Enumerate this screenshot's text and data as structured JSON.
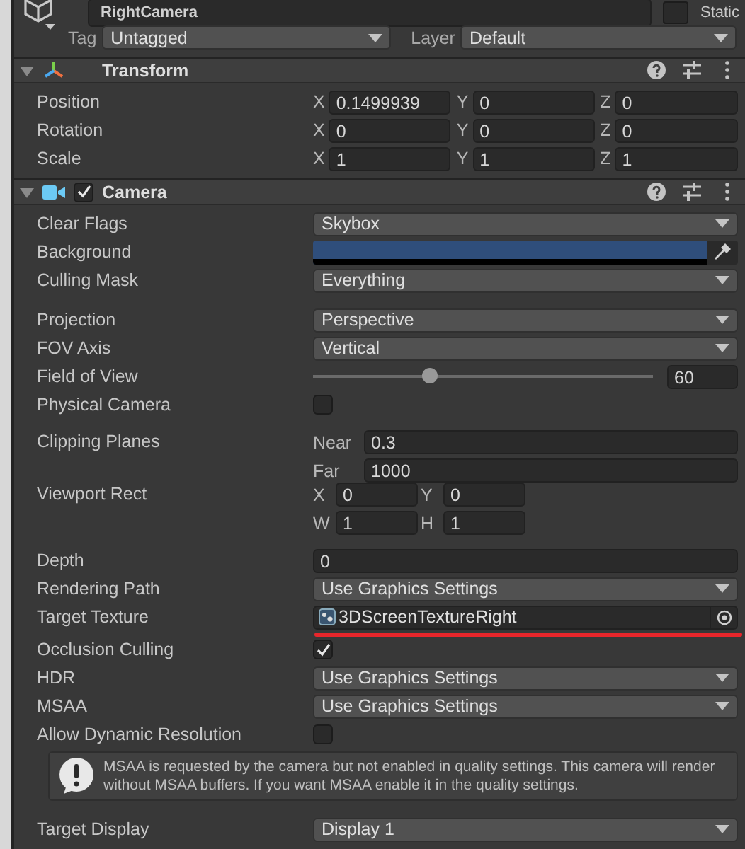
{
  "object_header": {
    "name": "RightCamera",
    "static_label": "Static",
    "static": false,
    "tag_label": "Tag",
    "tag": "Untagged",
    "layer_label": "Layer",
    "layer": "Default"
  },
  "components": [
    {
      "kind": "transform",
      "title": "Transform",
      "expanded": true,
      "rows": [
        {
          "label": "Position",
          "fields": [
            {
              "axis": "X",
              "value": "0.1499939"
            },
            {
              "axis": "Y",
              "value": "0"
            },
            {
              "axis": "Z",
              "value": "0"
            }
          ]
        },
        {
          "label": "Rotation",
          "fields": [
            {
              "axis": "X",
              "value": "0"
            },
            {
              "axis": "Y",
              "value": "0"
            },
            {
              "axis": "Z",
              "value": "0"
            }
          ]
        },
        {
          "label": "Scale",
          "fields": [
            {
              "axis": "X",
              "value": "1"
            },
            {
              "axis": "Y",
              "value": "1"
            },
            {
              "axis": "Z",
              "value": "1"
            }
          ]
        }
      ]
    },
    {
      "kind": "camera",
      "title": "Camera",
      "expanded": true,
      "enabled": true,
      "properties": [
        {
          "kind": "dropdown",
          "label": "Clear Flags",
          "value": "Skybox"
        },
        {
          "kind": "color",
          "label": "Background",
          "color": "#2f4e7b"
        },
        {
          "kind": "dropdown",
          "label": "Culling Mask",
          "value": "Everything"
        },
        {
          "kind": "dropdown",
          "label": "Projection",
          "value": "Perspective",
          "group_start": true
        },
        {
          "kind": "dropdown",
          "label": "FOV Axis",
          "value": "Vertical"
        },
        {
          "kind": "slider",
          "label": "Field of View",
          "level": 0.34,
          "value": "60"
        },
        {
          "kind": "checkbox",
          "label": "Physical Camera",
          "checked": false
        },
        {
          "kind": "pair",
          "label": "Clipping Planes",
          "group_start": true,
          "fields": [
            {
              "axis": "Near",
              "value": "0.3"
            },
            {
              "axis": "Far",
              "value": "1000"
            }
          ]
        },
        {
          "kind": "rect",
          "label": "Viewport Rect",
          "fields": [
            {
              "axis": "X",
              "value": "0"
            },
            {
              "axis": "Y",
              "value": "0"
            },
            {
              "axis": "W",
              "value": "1"
            },
            {
              "axis": "H",
              "value": "1"
            }
          ]
        },
        {
          "kind": "text",
          "label": "Depth",
          "value": "0",
          "group_start": true
        },
        {
          "kind": "dropdown",
          "label": "Rendering Path",
          "value": "Use Graphics Settings"
        },
        {
          "kind": "object",
          "label": "Target Texture",
          "value": "3DScreenTextureRight",
          "underlined": true
        },
        {
          "kind": "checkbox",
          "label": "Occlusion Culling",
          "checked": true
        },
        {
          "kind": "dropdown",
          "label": "HDR",
          "value": "Use Graphics Settings"
        },
        {
          "kind": "dropdown",
          "label": "MSAA",
          "value": "Use Graphics Settings"
        },
        {
          "kind": "checkbox",
          "label": "Allow Dynamic Resolution",
          "checked": false
        },
        {
          "kind": "help",
          "text": "MSAA is requested by the camera but not enabled in quality settings. This camera will render without MSAA buffers. If you want MSAA enable it in the quality settings."
        },
        {
          "kind": "dropdown",
          "label": "Target Display",
          "value": "Display 1",
          "group_start": true
        }
      ]
    }
  ]
}
